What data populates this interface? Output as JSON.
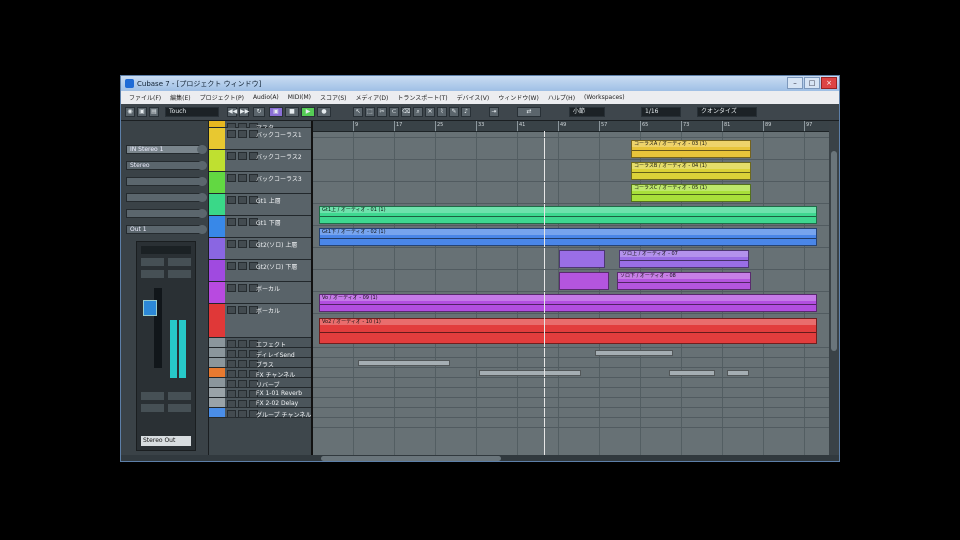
{
  "window": {
    "title": "Cubase 7 - [プロジェクト ウィンドウ]",
    "accent": "#1e6bd6"
  },
  "menu": [
    "ファイル(F)",
    "編集(E)",
    "プロジェクト(P)",
    "Audio(A)",
    "MIDI(M)",
    "スコア(S)",
    "メディア(D)",
    "トランスポート(T)",
    "デバイス(V)",
    "ウィンドウ(W)",
    "ハルプ(H)",
    "(Workspaces)"
  ],
  "toolbar": {
    "touch_mode": "Touch",
    "grid_type": "小節",
    "quantize": "1/16",
    "quantize_mode": "クオンタイズ"
  },
  "inspector": {
    "rows": [
      "IN Stereo 1",
      "Stereo",
      "",
      "",
      "",
      "Out 1"
    ],
    "output": "Stereo Out"
  },
  "ruler": [
    "9",
    "17",
    "25",
    "33",
    "41",
    "49",
    "57",
    "65",
    "73",
    "81",
    "89",
    "97"
  ],
  "tracks": [
    {
      "name": "マスタ",
      "color": "#e8b820"
    },
    {
      "name": "バックコーラス1",
      "color": "#e8c830"
    },
    {
      "name": "バックコーラス2",
      "color": "#bfe030"
    },
    {
      "name": "バックコーラス3",
      "color": "#62d842"
    },
    {
      "name": "Gt1 上層",
      "color": "#3ad888"
    },
    {
      "name": "Gt1 下層",
      "color": "#3888e8"
    },
    {
      "name": "Gt2(ソロ) 上層",
      "color": "#8a66e2"
    },
    {
      "name": "Gt2(ソロ) 下層",
      "color": "#a04ae0"
    },
    {
      "name": "ボーカル",
      "color": "#b84ae0"
    },
    {
      "name": "ボーカル",
      "color": "#e03838"
    },
    {
      "name": "エフェクト",
      "color": "#8b969c"
    },
    {
      "name": "ディレイSend",
      "color": "#8b969c"
    },
    {
      "name": "ブラス",
      "color": "#8b969c"
    },
    {
      "name": "FX チャンネル",
      "color": "#e87a30"
    },
    {
      "name": "リバーブ",
      "color": "#8b969c"
    },
    {
      "name": "FX 1-01 Reverb",
      "color": "#9aa3a8"
    },
    {
      "name": "FX 2-02 Delay",
      "color": "#9aa3a8"
    },
    {
      "name": "グループ チャンネル",
      "color": "#4a8ee8"
    }
  ],
  "clips": [
    {
      "label": "コーラスA / オーディオ - 03 (1)",
      "color": "#e8c43a"
    },
    {
      "label": "コーラスB / オーディオ - 04 (1)",
      "color": "#dcd238"
    },
    {
      "label": "コーラスC / オーディオ - 05 (1)",
      "color": "#a8e03a"
    },
    {
      "label": "Gt1上 / オーディオ - 01 (1)",
      "color": "#3ed890"
    },
    {
      "label": "Gt1下 / オーディオ - 02 (1)",
      "color": "#4a86e8"
    },
    {
      "label": "",
      "color": "#9a6ee6"
    },
    {
      "label": "ソロ上 / オーディオ - 07",
      "color": "#9a6ee6"
    },
    {
      "label": "",
      "color": "#b455de"
    },
    {
      "label": "ソロ下 / オーディオ - 08",
      "color": "#b455de"
    },
    {
      "label": "Vo / オーディオ - 09 (1)",
      "color": "#b24ee0"
    },
    {
      "label": "Vo2 / オーディオ - 10 (1)",
      "color": "#e23d3d"
    },
    {
      "label": "",
      "color": "#a5aeb3"
    },
    {
      "label": "",
      "color": "#a5aeb3"
    },
    {
      "label": "",
      "color": "#a5aeb3"
    },
    {
      "label": "",
      "color": "#a5aeb3"
    },
    {
      "label": "",
      "color": "#a5aeb3"
    }
  ]
}
